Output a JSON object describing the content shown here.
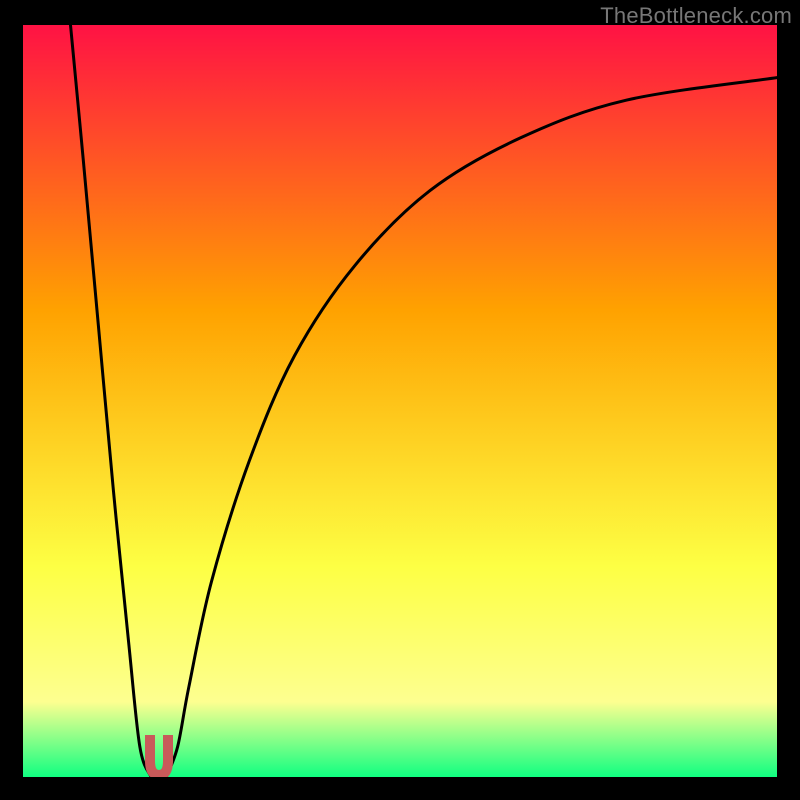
{
  "watermark": "TheBottleneck.com",
  "chart_data": {
    "type": "line",
    "title": "",
    "xlabel": "",
    "ylabel": "",
    "xlim": [
      0,
      100
    ],
    "ylim": [
      0,
      100
    ],
    "grid": false,
    "legend": "none",
    "background_gradient": {
      "top": "#ff1244",
      "mid_upper": "#ffa200",
      "mid_lower": "#fdff44",
      "near_bottom": "#fdff90",
      "bottom": "#10ff81"
    },
    "series": [
      {
        "name": "curve-left",
        "x": [
          6.3,
          8,
          10,
          12,
          14,
          15.5,
          17.0
        ],
        "y": [
          100,
          82,
          60,
          38,
          18,
          4,
          0
        ]
      },
      {
        "name": "curve-right",
        "x": [
          19.0,
          20.5,
          22,
          25,
          30,
          36,
          44,
          54,
          66,
          80,
          100
        ],
        "y": [
          0,
          4,
          12,
          26,
          42,
          56,
          68,
          78,
          85,
          90,
          93
        ]
      }
    ],
    "marker": {
      "name": "u-marker",
      "x": 18.0,
      "y": 0,
      "color": "#c85a5a",
      "shape": "rounded-u"
    }
  }
}
